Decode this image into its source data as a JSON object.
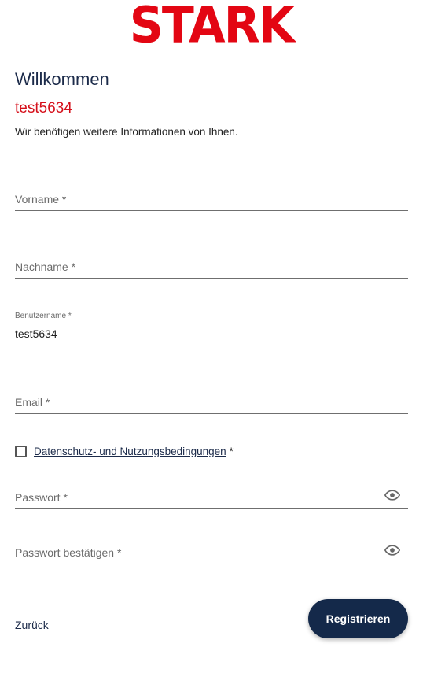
{
  "brand": {
    "logo_text": "STARK",
    "accent_color": "#e30613"
  },
  "header": {
    "welcome": "Willkommen",
    "username": "test5634",
    "subtitle": "Wir benötigen weitere Informationen von Ihnen."
  },
  "form": {
    "firstname": {
      "placeholder": "Vorname *",
      "value": ""
    },
    "lastname": {
      "placeholder": "Nachname *",
      "value": ""
    },
    "username": {
      "label": "Benutzername *",
      "value": "test5634"
    },
    "email": {
      "placeholder": "Email *",
      "value": ""
    },
    "terms": {
      "link_text": "Datenschutz- und Nutzungsbedingungen",
      "required_mark": " *",
      "checked": false
    },
    "password": {
      "placeholder": "Passwort *",
      "value": "",
      "icon": "eye-icon"
    },
    "password_confirm": {
      "placeholder": "Passwort bestätigen *",
      "value": "",
      "icon": "eye-icon"
    }
  },
  "actions": {
    "back_label": "Zurück",
    "register_label": "Registrieren",
    "button_color": "#14294a"
  }
}
